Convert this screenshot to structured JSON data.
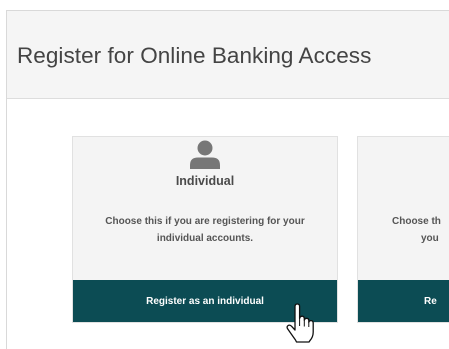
{
  "page": {
    "title": "Register for Online Banking Access"
  },
  "cards": {
    "individual": {
      "title": "Individual",
      "description": "Choose this if you are registering for your individual accounts.",
      "button_label": "Register as an individual",
      "icon": "user-icon"
    },
    "business": {
      "description_line1": "Choose th",
      "description_line2": "you",
      "button_label": "Re"
    }
  },
  "colors": {
    "header_bg": "#f5f5f5",
    "card_bg": "#f4f4f4",
    "button_bg": "#0c4c54",
    "button_text": "#ffffff",
    "icon": "#777777"
  },
  "cursor": {
    "icon": "hand-pointer-icon"
  }
}
